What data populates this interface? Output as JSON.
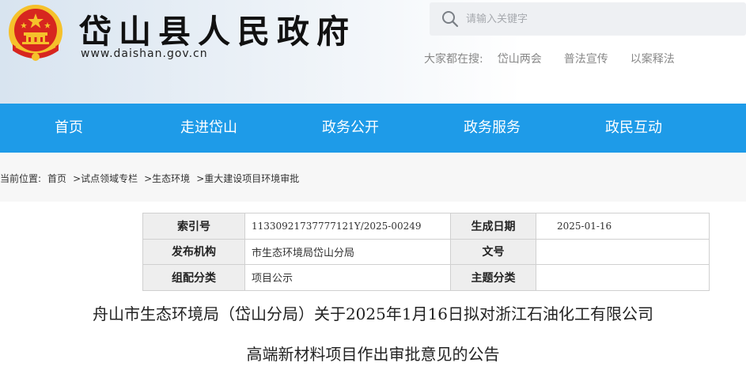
{
  "header": {
    "site_title": "岱山县人民政府",
    "site_url": "www.daishan.gov.cn",
    "search_placeholder": "请输入关键字",
    "hot_search_label": "大家都在搜:",
    "hot_search_links": [
      "岱山两会",
      "普法宣传",
      "以案释法"
    ]
  },
  "nav": {
    "items": [
      "首页",
      "走进岱山",
      "政务公开",
      "政务服务",
      "政民互动"
    ]
  },
  "breadcrumb": {
    "label": "当前位置:",
    "items": [
      "首页",
      ">试点领域专栏",
      ">生态环境",
      ">重大建设项目环境审批"
    ]
  },
  "info_table": {
    "index_label": "索引号",
    "index_value": "11330921737777121Y/2025-00249",
    "date_label": "生成日期",
    "date_value": "2025-01-16",
    "org_label": "发布机构",
    "org_value": "市生态环境局岱山分局",
    "doc_no_label": "文号",
    "doc_no_value": "",
    "category_label": "组配分类",
    "category_value": "项目公示",
    "topic_label": "主题分类",
    "topic_value": ""
  },
  "article": {
    "title_line1": "舟山市生态环境局（岱山分局）关于2025年1月16日拟对浙江石油化工有限公司",
    "title_line2": "高端新材料项目作出审批意见的公告"
  },
  "colors": {
    "nav_bg": "#1e9be8",
    "emblem_red": "#d7261f",
    "emblem_gold": "#f5c12b"
  }
}
